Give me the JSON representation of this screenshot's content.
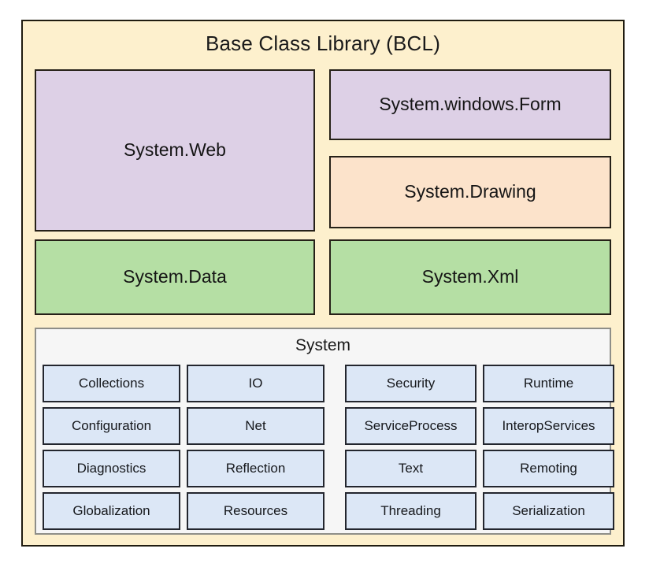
{
  "diagram": {
    "title": "Base Class Library (BCL)",
    "colors": {
      "background": "#fdf0cd",
      "border": "#262118",
      "purple": "#ddd0e6",
      "peach": "#fce3cb",
      "green": "#b5dfa4",
      "panel": "#f6f6f6",
      "panel_border": "#8e8e88",
      "cell": "#dce7f6",
      "cell_border": "#23262e"
    },
    "modules": [
      {
        "label": "System.Web",
        "fill": "purple"
      },
      {
        "label": "System.windows.Form",
        "fill": "purple"
      },
      {
        "label": "System.Drawing",
        "fill": "peach"
      },
      {
        "label": "System.Data",
        "fill": "green"
      },
      {
        "label": "System.Xml",
        "fill": "green"
      }
    ],
    "system_panel": {
      "title": "System",
      "rows": [
        [
          "Collections",
          "IO",
          "Security",
          "Runtime"
        ],
        [
          "Configuration",
          "Net",
          "ServiceProcess",
          "InteropServices"
        ],
        [
          "Diagnostics",
          "Reflection",
          "Text",
          "Remoting"
        ],
        [
          "Globalization",
          "Resources",
          "Threading",
          "Serialization"
        ]
      ]
    }
  }
}
